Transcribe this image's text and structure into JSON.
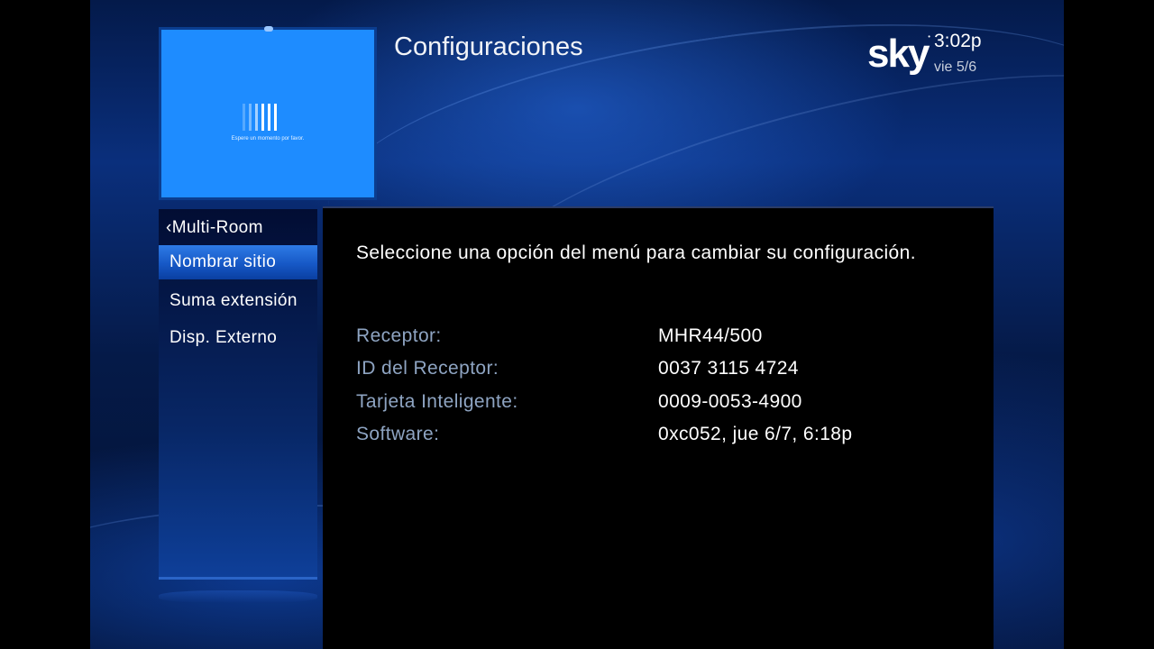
{
  "header": {
    "title": "Configuraciones",
    "logo_text": "sky",
    "time": "3:02p",
    "date": "vie 5/6"
  },
  "preview": {
    "message": "Espere un momento por favor."
  },
  "menu": {
    "back_label": "Multi-Room",
    "items": [
      {
        "label": "Nombrar sitio",
        "selected": true
      },
      {
        "label": "Suma extensión",
        "selected": false
      },
      {
        "label": "Disp. Externo",
        "selected": false
      }
    ]
  },
  "panel": {
    "instructions": "Seleccione una opción del menú para cambiar su configuración.",
    "rows": [
      {
        "label": "Receptor:",
        "value": "MHR44/500"
      },
      {
        "label": "ID del Receptor:",
        "value": "0037 3115 4724"
      },
      {
        "label": "Tarjeta Inteligente:",
        "value": "0009-0053-4900"
      },
      {
        "label": "Software:",
        "value": "0xc052, jue 6/7, 6:18p"
      }
    ]
  },
  "colors": {
    "accent": "#1e8cff",
    "selected": "#1658c6",
    "label": "#8ea4c2"
  }
}
